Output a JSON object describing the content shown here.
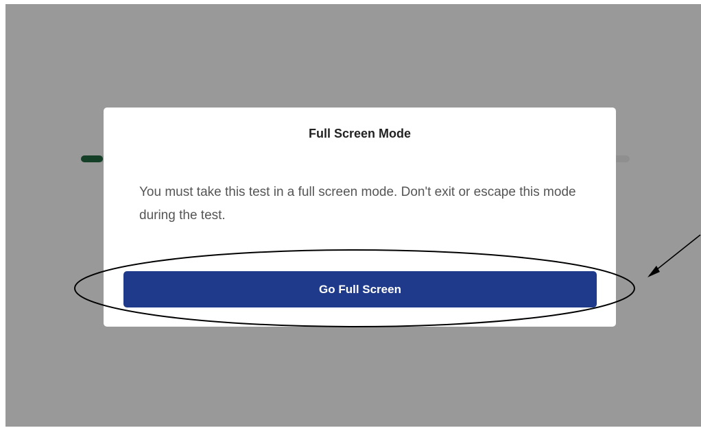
{
  "modal": {
    "title": "Full Screen Mode",
    "message": "You must take this test in a full screen mode. Don't exit or escape this mode during the test.",
    "button_label": "Go Full Screen"
  },
  "background": {
    "progress_fraction": 0.04
  },
  "colors": {
    "overlay": "#999999",
    "primary_button": "#1f3a8a",
    "progress_fill": "#163f28"
  },
  "annotations": {
    "highlight_shape": "ellipse",
    "pointer": "arrow"
  }
}
